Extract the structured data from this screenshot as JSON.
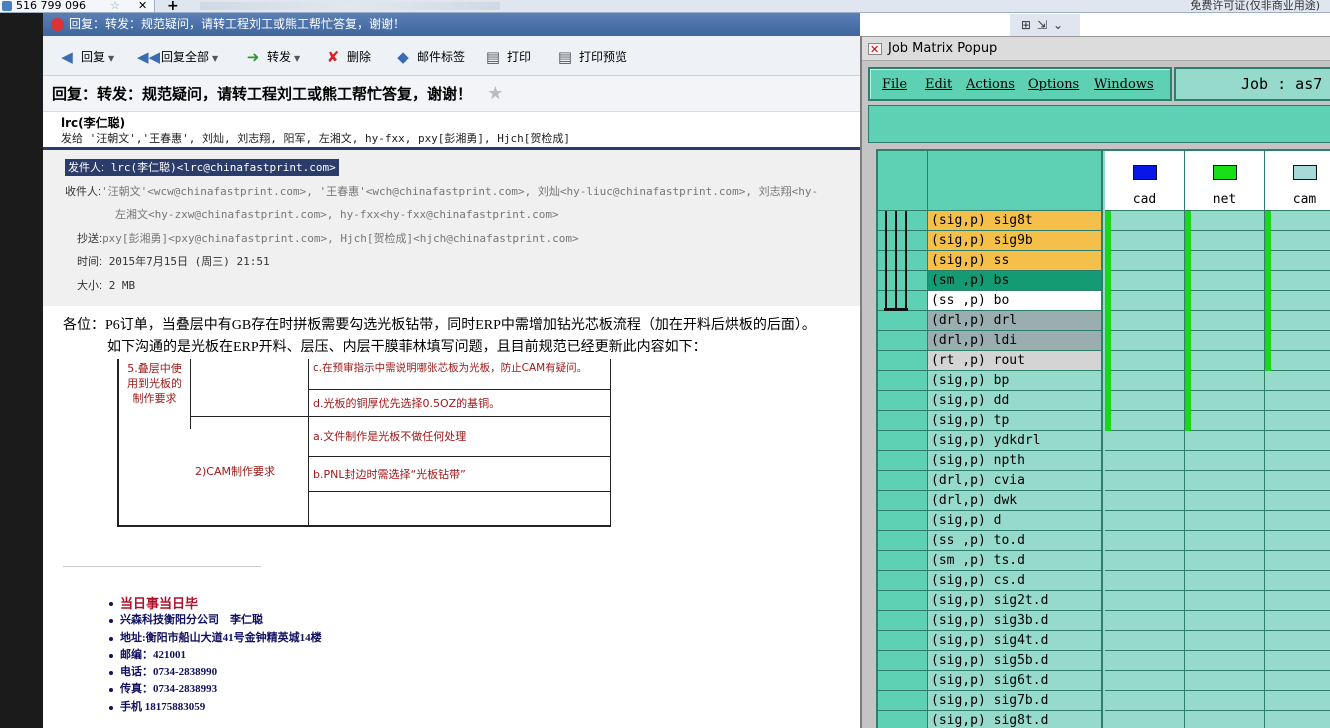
{
  "browser": {
    "tab_title": "516 799 096",
    "license_text": "免费许可证(仅非商业用途)"
  },
  "mail": {
    "window_title": "回复：转发：规范疑问，请转工程刘工或熊工帮忙答复，谢谢！",
    "toolbar": {
      "reply": "回复",
      "reply_all": "回复全部",
      "forward": "转发",
      "delete": "删除",
      "tag": "邮件标签",
      "print": "打印",
      "print_preview": "打印预览"
    },
    "subject": "回复：转发：规范疑问，请转工程刘工或熊工帮忙答复，谢谢！",
    "sender_name": "lrc(李仁聪)",
    "sendto": "发给 '汪朝文','王春惠', 刘灿, 刘志翔, 阳军, 左湘文, hy-fxx, pxy[彭湘勇], Hjch[贺检成]",
    "headers": {
      "from_label": "发件人:",
      "from_value": "lrc(李仁聪)<lrc@chinafastprint.com>",
      "to_label": "收件人:",
      "to_value": "'汪朝文'<wcw@chinafastprint.com>, '王春惠'<wch@chinafastprint.com>, 刘灿<hy-liuc@chinafastprint.com>, 刘志翔<hy-",
      "to_value2": "左湘文<hy-zxw@chinafastprint.com>, hy-fxx<hy-fxx@chinafastprint.com>",
      "cc_label": "抄送:",
      "cc_value": "pxy[彭湘勇]<pxy@chinafastprint.com>, Hjch[贺检成]<hjch@chinafastprint.com>",
      "time_label": "时间:",
      "time_value": "2015年7月15日 (周三) 21:51",
      "size_label": "大小:",
      "size_value": "2 MB"
    },
    "body_line1": "各位：P6订单，当叠层中有GB存在时拼板需要勾选光板钻带，同时ERP中需增加钻光芯板流程（加在开料后烘板的后面）。",
    "body_line2": "如下沟通的是光板在ERP开料、层压、内层干膜菲林填写问题，且目前规范已经更新此内容如下：",
    "table": {
      "c1": "5.叠层中使用到光板的制作要求",
      "c2": "c.在预审指示中需说明哪张芯板为光板，防止CAM有疑问。",
      "c3": "d.光板的铜厚优先选择0.5OZ的基铜。",
      "c4": "2)CAM制作要求",
      "c5": "a.文件制作是光板不做任何处理",
      "c6": "b.PNL封边时需选择“光板钻带”"
    },
    "signature": [
      "当日事当日毕",
      "兴森科技衡阳分公司　李仁聪",
      "地址:衡阳市船山大道41号金钟精英城14楼",
      "邮编：421001",
      "电话：0734-2838990",
      "传真：0734-2838993",
      "手机 18175883059"
    ]
  },
  "job_matrix": {
    "title": "Job Matrix Popup",
    "menu": [
      "File",
      "Edit",
      "Actions",
      "Options",
      "Windows"
    ],
    "job_label": "Job : as7",
    "columns": [
      {
        "name": "cad",
        "color": "#0a16e8"
      },
      {
        "name": "net",
        "color": "#18e018"
      },
      {
        "name": "cam",
        "color": "#a9d8d8"
      }
    ],
    "rows": [
      {
        "name": "(sig,p) sig8t",
        "bg": "#f5c04a",
        "marks": [
          1,
          1,
          1
        ]
      },
      {
        "name": "(sig,p) sig9b",
        "bg": "#f5c04a",
        "marks": [
          1,
          1,
          1
        ]
      },
      {
        "name": "(sig,p) ss",
        "bg": "#f5c04a",
        "marks": [
          1,
          1,
          1
        ]
      },
      {
        "name": "(sm ,p) bs",
        "bg": "#159b74",
        "marks": [
          1,
          1,
          1
        ]
      },
      {
        "name": "(ss ,p) bo",
        "bg": "#ffffff",
        "marks": [
          1,
          1,
          1
        ]
      },
      {
        "name": "(drl,p) drl",
        "bg": "#9aaeb0",
        "marks": [
          1,
          1,
          1
        ]
      },
      {
        "name": "(drl,p) ldi",
        "bg": "#9aaeb0",
        "marks": [
          1,
          1,
          1
        ]
      },
      {
        "name": "(rt ,p) rout",
        "bg": "#d4d4d4",
        "marks": [
          1,
          1,
          1
        ]
      },
      {
        "name": "(sig,p) bp",
        "bg": "#96dacc",
        "marks": [
          1,
          1,
          0
        ]
      },
      {
        "name": "(sig,p) dd",
        "bg": "#96dacc",
        "marks": [
          1,
          1,
          0
        ]
      },
      {
        "name": "(sig,p) tp",
        "bg": "#96dacc",
        "marks": [
          1,
          1,
          0
        ]
      },
      {
        "name": "(sig,p) ydkdrl",
        "bg": "#96dacc",
        "marks": [
          0,
          0,
          0
        ]
      },
      {
        "name": "(sig,p) npth",
        "bg": "#96dacc",
        "marks": [
          0,
          0,
          0
        ]
      },
      {
        "name": "(drl,p) cvia",
        "bg": "#96dacc",
        "marks": [
          0,
          0,
          0
        ]
      },
      {
        "name": "(drl,p) dwk",
        "bg": "#96dacc",
        "marks": [
          0,
          0,
          0
        ]
      },
      {
        "name": "(sig,p) d",
        "bg": "#96dacc",
        "marks": [
          0,
          0,
          0
        ]
      },
      {
        "name": "(ss ,p) to.d",
        "bg": "#96dacc",
        "marks": [
          0,
          0,
          0
        ]
      },
      {
        "name": "(sm ,p) ts.d",
        "bg": "#96dacc",
        "marks": [
          0,
          0,
          0
        ]
      },
      {
        "name": "(sig,p) cs.d",
        "bg": "#96dacc",
        "marks": [
          0,
          0,
          0
        ]
      },
      {
        "name": "(sig,p) sig2t.d",
        "bg": "#96dacc",
        "marks": [
          0,
          0,
          0
        ]
      },
      {
        "name": "(sig,p) sig3b.d",
        "bg": "#96dacc",
        "marks": [
          0,
          0,
          0
        ]
      },
      {
        "name": "(sig,p) sig4t.d",
        "bg": "#96dacc",
        "marks": [
          0,
          0,
          0
        ]
      },
      {
        "name": "(sig,p) sig5b.d",
        "bg": "#96dacc",
        "marks": [
          0,
          0,
          0
        ]
      },
      {
        "name": "(sig,p) sig6t.d",
        "bg": "#96dacc",
        "marks": [
          0,
          0,
          0
        ]
      },
      {
        "name": "(sig,p) sig7b.d",
        "bg": "#96dacc",
        "marks": [
          0,
          0,
          0
        ]
      },
      {
        "name": "(sig,p) sig8t.d",
        "bg": "#96dacc",
        "marks": [
          0,
          0,
          0
        ]
      }
    ]
  }
}
